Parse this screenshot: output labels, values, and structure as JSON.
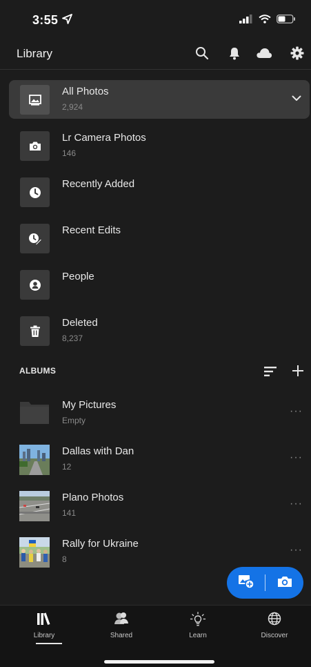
{
  "status_bar": {
    "time": "3:55"
  },
  "header": {
    "title": "Library",
    "icons": [
      "search-icon",
      "bell-icon",
      "cloud-icon",
      "gear-icon"
    ]
  },
  "nav": [
    {
      "label": "All Photos",
      "count": "2,924",
      "icon": "photo-icon",
      "selected": true
    },
    {
      "label": "Lr Camera Photos",
      "count": "146",
      "icon": "camera-icon"
    },
    {
      "label": "Recently Added",
      "count": "",
      "icon": "clock-icon"
    },
    {
      "label": "Recent Edits",
      "count": "",
      "icon": "edit-clock-icon"
    },
    {
      "label": "People",
      "count": "",
      "icon": "person-icon"
    },
    {
      "label": "Deleted",
      "count": "8,237",
      "icon": "trash-icon"
    }
  ],
  "albums": {
    "title": "ALBUMS",
    "items": [
      {
        "label": "My Pictures",
        "count": "Empty",
        "thumb": "folder"
      },
      {
        "label": "Dallas with Dan",
        "count": "12",
        "thumb": "city"
      },
      {
        "label": "Plano Photos",
        "count": "141",
        "thumb": "road"
      },
      {
        "label": "Rally for Ukraine",
        "count": "8",
        "thumb": "crowd"
      }
    ],
    "more_label": "···"
  },
  "fab": {
    "color": "#1473e6"
  },
  "tabs": [
    {
      "label": "Library",
      "icon": "library-icon",
      "active": true
    },
    {
      "label": "Shared",
      "icon": "people-icon"
    },
    {
      "label": "Learn",
      "icon": "lightbulb-icon"
    },
    {
      "label": "Discover",
      "icon": "globe-icon"
    }
  ],
  "colors": {
    "background": "#1c1c1c",
    "selected_row": "#3a3a3a",
    "accent": "#1473e6"
  }
}
